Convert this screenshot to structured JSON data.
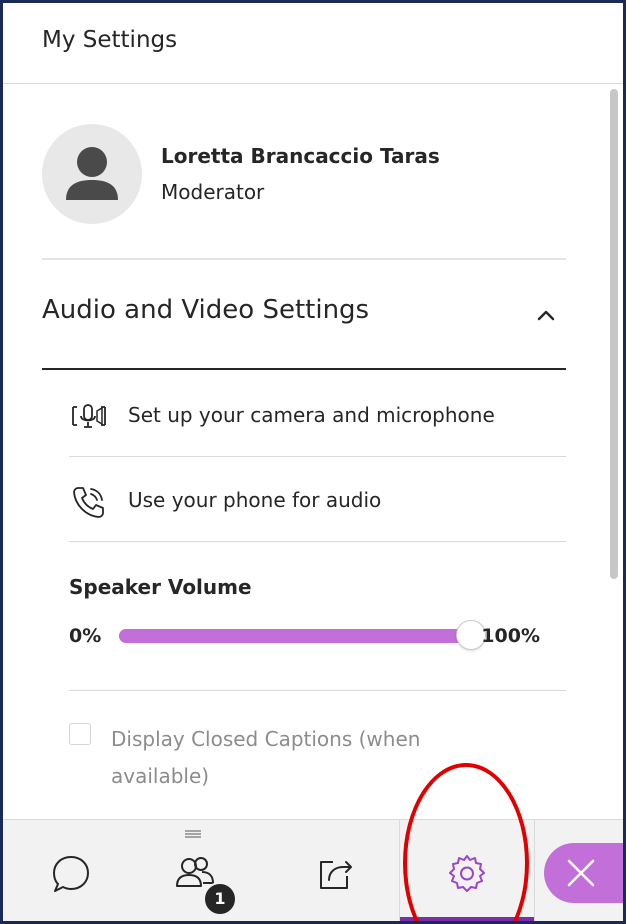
{
  "panel": {
    "title": "My Settings"
  },
  "profile": {
    "name": "Loretta Brancaccio Taras",
    "role": "Moderator"
  },
  "audio_video": {
    "section_title": "Audio and Video Settings",
    "expanded": true,
    "items": [
      {
        "label": "Set up your camera and microphone",
        "icon": "camera-microphone-icon"
      },
      {
        "label": "Use your phone for audio",
        "icon": "phone-icon"
      }
    ],
    "speaker_volume": {
      "title": "Speaker Volume",
      "min_label": "0%",
      "max_label": "100%",
      "value_percent": 100
    },
    "closed_captions": {
      "label": "Display Closed Captions (when available)",
      "checked": false,
      "disabled": true
    }
  },
  "bottom_bar": {
    "tabs": [
      {
        "name": "chat",
        "icon": "chat-icon"
      },
      {
        "name": "attendees",
        "icon": "attendees-icon",
        "badge": "1"
      },
      {
        "name": "share-content",
        "icon": "share-icon"
      },
      {
        "name": "settings",
        "icon": "gear-icon",
        "active": true
      }
    ],
    "close_icon": "close-icon"
  },
  "colors": {
    "accent": "#c36fd9",
    "active_tab": "#7a2fa8",
    "frame": "#1a2a57",
    "annotation": "#e00000"
  }
}
